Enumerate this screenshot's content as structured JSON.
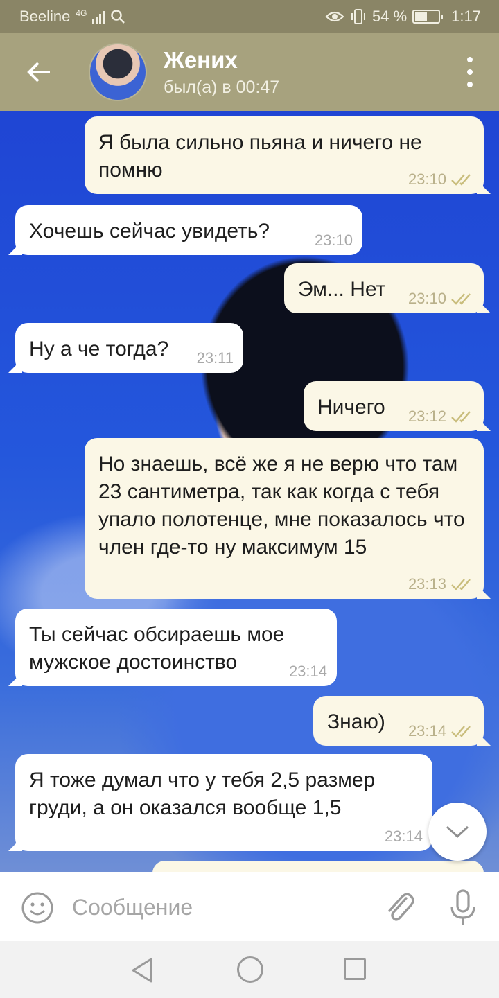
{
  "status_bar": {
    "carrier": "Beeline",
    "network": "4G",
    "battery": "54 %",
    "battery_level": 0.54,
    "time": "1:17"
  },
  "header": {
    "contact_name": "Жених",
    "last_seen": "был(а) в 00:47"
  },
  "messages": [
    {
      "direction": "out",
      "text": "Я была сильно пьяна и ничего не помню",
      "time": "23:10",
      "read": true
    },
    {
      "direction": "in",
      "text": "Хочешь сейчас увидеть?",
      "time": "23:10"
    },
    {
      "direction": "out",
      "text": "Эм... Нет",
      "time": "23:10",
      "read": true
    },
    {
      "direction": "in",
      "text": "Ну а че тогда?",
      "time": "23:11"
    },
    {
      "direction": "out",
      "text": "Ничего",
      "time": "23:12",
      "read": true
    },
    {
      "direction": "out",
      "text": "Но знаешь, всё же я не верю что там 23 сантиметра, так как когда с тебя упало полотенце, мне показалось что член где-то ну максимум 15",
      "time": "23:13",
      "read": true
    },
    {
      "direction": "in",
      "text": "Ты сейчас обсираешь мое мужское достоинство",
      "time": "23:14"
    },
    {
      "direction": "out",
      "text": "Знаю)",
      "time": "23:14",
      "read": true
    },
    {
      "direction": "in",
      "text": "Я тоже думал что у тебя 2,5 размер груди, а он оказался вообще 1,5",
      "time": "23:14"
    }
  ],
  "input": {
    "placeholder": "Сообщение",
    "value": ""
  },
  "icons": {
    "back": "arrow-left-icon",
    "menu": "more-vertical-icon",
    "scroll_down": "chevron-down-icon",
    "emoji": "smiley-icon",
    "attach": "paperclip-icon",
    "mic": "microphone-icon"
  },
  "colors": {
    "header": "#a7a27e",
    "status_bar": "#8a8566",
    "outgoing_bubble": "#fbf7e6",
    "incoming_bubble": "#ffffff",
    "read_checks": "#c9bd7c"
  }
}
